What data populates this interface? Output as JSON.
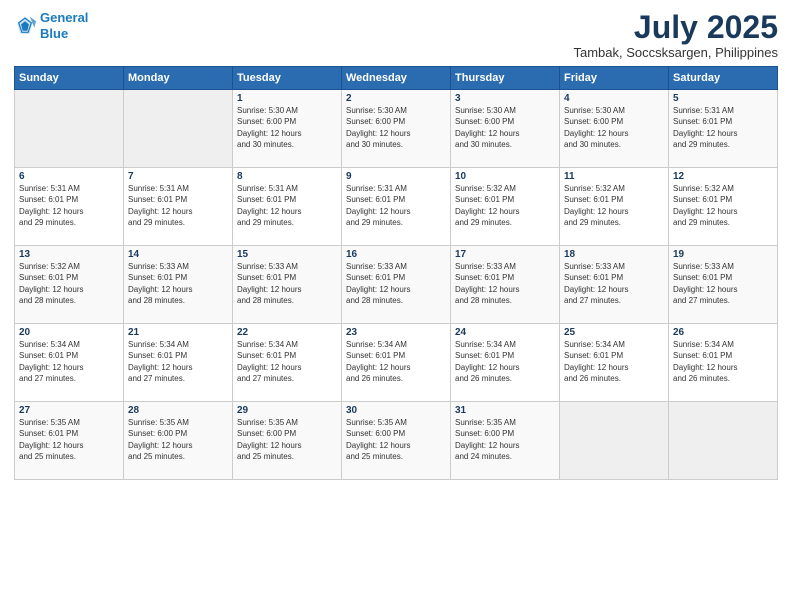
{
  "header": {
    "logo_line1": "General",
    "logo_line2": "Blue",
    "title": "July 2025",
    "location": "Tambak, Soccsksargen, Philippines"
  },
  "days_of_week": [
    "Sunday",
    "Monday",
    "Tuesday",
    "Wednesday",
    "Thursday",
    "Friday",
    "Saturday"
  ],
  "weeks": [
    [
      {
        "num": "",
        "info": ""
      },
      {
        "num": "",
        "info": ""
      },
      {
        "num": "1",
        "info": "Sunrise: 5:30 AM\nSunset: 6:00 PM\nDaylight: 12 hours\nand 30 minutes."
      },
      {
        "num": "2",
        "info": "Sunrise: 5:30 AM\nSunset: 6:00 PM\nDaylight: 12 hours\nand 30 minutes."
      },
      {
        "num": "3",
        "info": "Sunrise: 5:30 AM\nSunset: 6:00 PM\nDaylight: 12 hours\nand 30 minutes."
      },
      {
        "num": "4",
        "info": "Sunrise: 5:30 AM\nSunset: 6:00 PM\nDaylight: 12 hours\nand 30 minutes."
      },
      {
        "num": "5",
        "info": "Sunrise: 5:31 AM\nSunset: 6:01 PM\nDaylight: 12 hours\nand 29 minutes."
      }
    ],
    [
      {
        "num": "6",
        "info": "Sunrise: 5:31 AM\nSunset: 6:01 PM\nDaylight: 12 hours\nand 29 minutes."
      },
      {
        "num": "7",
        "info": "Sunrise: 5:31 AM\nSunset: 6:01 PM\nDaylight: 12 hours\nand 29 minutes."
      },
      {
        "num": "8",
        "info": "Sunrise: 5:31 AM\nSunset: 6:01 PM\nDaylight: 12 hours\nand 29 minutes."
      },
      {
        "num": "9",
        "info": "Sunrise: 5:31 AM\nSunset: 6:01 PM\nDaylight: 12 hours\nand 29 minutes."
      },
      {
        "num": "10",
        "info": "Sunrise: 5:32 AM\nSunset: 6:01 PM\nDaylight: 12 hours\nand 29 minutes."
      },
      {
        "num": "11",
        "info": "Sunrise: 5:32 AM\nSunset: 6:01 PM\nDaylight: 12 hours\nand 29 minutes."
      },
      {
        "num": "12",
        "info": "Sunrise: 5:32 AM\nSunset: 6:01 PM\nDaylight: 12 hours\nand 29 minutes."
      }
    ],
    [
      {
        "num": "13",
        "info": "Sunrise: 5:32 AM\nSunset: 6:01 PM\nDaylight: 12 hours\nand 28 minutes."
      },
      {
        "num": "14",
        "info": "Sunrise: 5:33 AM\nSunset: 6:01 PM\nDaylight: 12 hours\nand 28 minutes."
      },
      {
        "num": "15",
        "info": "Sunrise: 5:33 AM\nSunset: 6:01 PM\nDaylight: 12 hours\nand 28 minutes."
      },
      {
        "num": "16",
        "info": "Sunrise: 5:33 AM\nSunset: 6:01 PM\nDaylight: 12 hours\nand 28 minutes."
      },
      {
        "num": "17",
        "info": "Sunrise: 5:33 AM\nSunset: 6:01 PM\nDaylight: 12 hours\nand 28 minutes."
      },
      {
        "num": "18",
        "info": "Sunrise: 5:33 AM\nSunset: 6:01 PM\nDaylight: 12 hours\nand 27 minutes."
      },
      {
        "num": "19",
        "info": "Sunrise: 5:33 AM\nSunset: 6:01 PM\nDaylight: 12 hours\nand 27 minutes."
      }
    ],
    [
      {
        "num": "20",
        "info": "Sunrise: 5:34 AM\nSunset: 6:01 PM\nDaylight: 12 hours\nand 27 minutes."
      },
      {
        "num": "21",
        "info": "Sunrise: 5:34 AM\nSunset: 6:01 PM\nDaylight: 12 hours\nand 27 minutes."
      },
      {
        "num": "22",
        "info": "Sunrise: 5:34 AM\nSunset: 6:01 PM\nDaylight: 12 hours\nand 27 minutes."
      },
      {
        "num": "23",
        "info": "Sunrise: 5:34 AM\nSunset: 6:01 PM\nDaylight: 12 hours\nand 26 minutes."
      },
      {
        "num": "24",
        "info": "Sunrise: 5:34 AM\nSunset: 6:01 PM\nDaylight: 12 hours\nand 26 minutes."
      },
      {
        "num": "25",
        "info": "Sunrise: 5:34 AM\nSunset: 6:01 PM\nDaylight: 12 hours\nand 26 minutes."
      },
      {
        "num": "26",
        "info": "Sunrise: 5:34 AM\nSunset: 6:01 PM\nDaylight: 12 hours\nand 26 minutes."
      }
    ],
    [
      {
        "num": "27",
        "info": "Sunrise: 5:35 AM\nSunset: 6:01 PM\nDaylight: 12 hours\nand 25 minutes."
      },
      {
        "num": "28",
        "info": "Sunrise: 5:35 AM\nSunset: 6:00 PM\nDaylight: 12 hours\nand 25 minutes."
      },
      {
        "num": "29",
        "info": "Sunrise: 5:35 AM\nSunset: 6:00 PM\nDaylight: 12 hours\nand 25 minutes."
      },
      {
        "num": "30",
        "info": "Sunrise: 5:35 AM\nSunset: 6:00 PM\nDaylight: 12 hours\nand 25 minutes."
      },
      {
        "num": "31",
        "info": "Sunrise: 5:35 AM\nSunset: 6:00 PM\nDaylight: 12 hours\nand 24 minutes."
      },
      {
        "num": "",
        "info": ""
      },
      {
        "num": "",
        "info": ""
      }
    ]
  ]
}
